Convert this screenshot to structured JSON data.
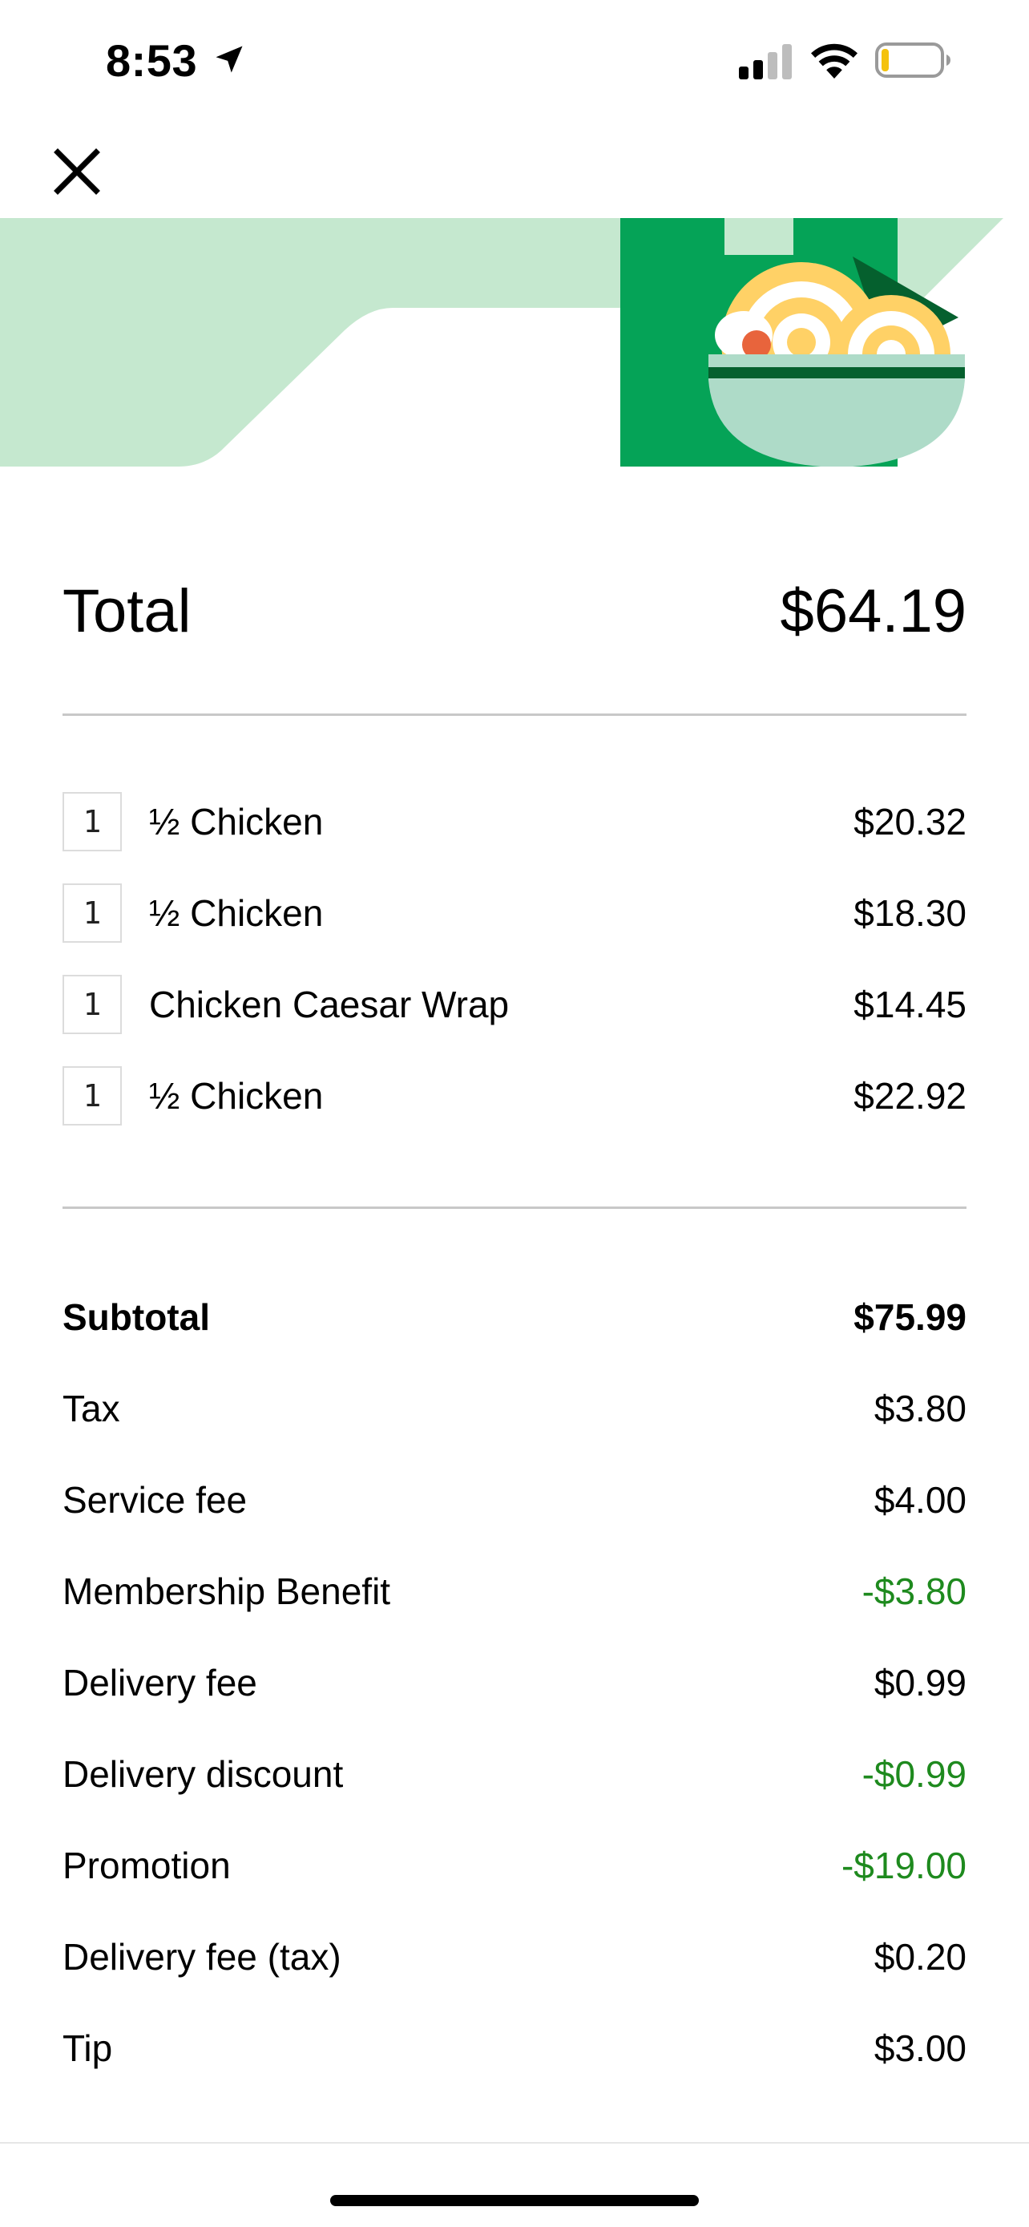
{
  "status_bar": {
    "time": "8:53",
    "icons": [
      "location-arrow-icon",
      "cellular-signal-icon",
      "wifi-icon",
      "battery-low-icon"
    ]
  },
  "header": {
    "close_icon": "close-icon"
  },
  "banner": {
    "illustration": "takeout-bag-with-noodle-bowl",
    "colors": {
      "light_green": "#c5e8cf",
      "bag_green": "#05a357",
      "dark_green": "#05602e",
      "bowl": "#aedbc8",
      "noodles": "#ffd166",
      "egg": "#ffffff",
      "carrot": "#e8643c"
    }
  },
  "total": {
    "label": "Total",
    "value": "$64.19"
  },
  "items": [
    {
      "qty": "1",
      "name": "½ Chicken",
      "price": "$20.32"
    },
    {
      "qty": "1",
      "name": "½ Chicken",
      "price": "$18.30"
    },
    {
      "qty": "1",
      "name": "Chicken Caesar Wrap",
      "price": "$14.45"
    },
    {
      "qty": "1",
      "name": "½ Chicken",
      "price": "$22.92"
    }
  ],
  "summary": [
    {
      "label": "Subtotal",
      "value": "$75.99",
      "bold": true
    },
    {
      "label": "Tax",
      "value": "$3.80"
    },
    {
      "label": "Service fee",
      "value": "$4.00"
    },
    {
      "label": "Membership Benefit",
      "value": "-$3.80",
      "discount": true
    },
    {
      "label": "Delivery fee",
      "value": "$0.99"
    },
    {
      "label": "Delivery discount",
      "value": "-$0.99",
      "discount": true
    },
    {
      "label": "Promotion",
      "value": "-$19.00",
      "discount": true
    },
    {
      "label": "Delivery fee (tax)",
      "value": "$0.20"
    },
    {
      "label": "Tip",
      "value": "$3.00"
    }
  ],
  "colors": {
    "discount_green": "#1e8a1e",
    "divider": "#c8c8c8",
    "text": "#000000"
  }
}
